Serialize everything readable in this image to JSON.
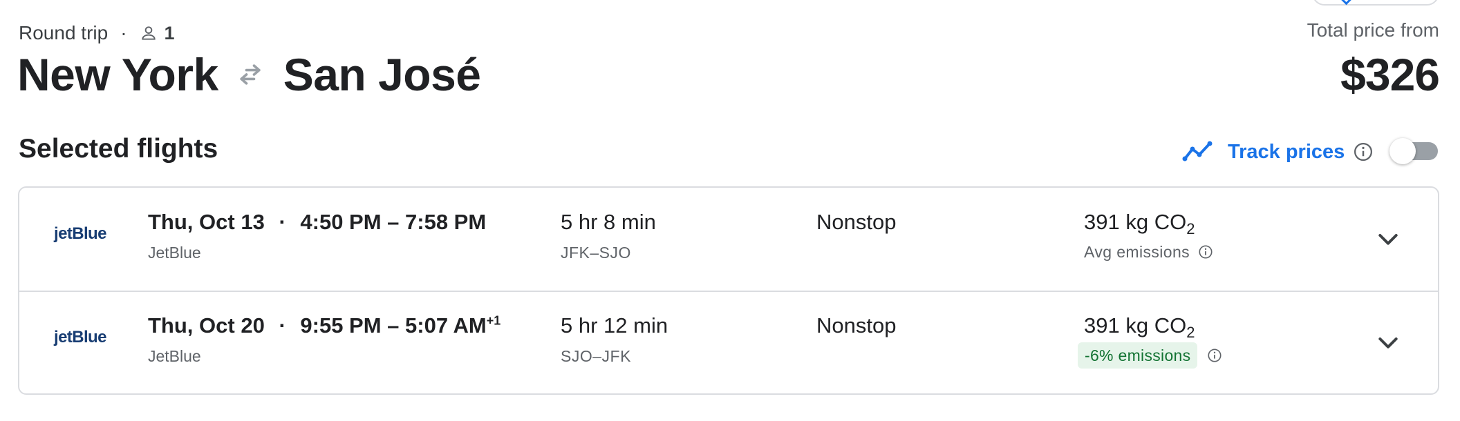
{
  "trip": {
    "type_label": "Round trip",
    "separator": "·",
    "passenger_count": "1",
    "icons": {
      "passenger": "person-icon"
    }
  },
  "route": {
    "origin": "New York",
    "destination": "San José",
    "icons": {
      "swap": "swap-arrows-icon"
    }
  },
  "price": {
    "label": "Total price from",
    "value": "$326"
  },
  "selected_flights": {
    "title": "Selected flights",
    "track_prices": {
      "label": "Track prices",
      "enabled": false,
      "icons": {
        "trend": "trend-line-icon",
        "info": "info-icon"
      }
    },
    "flights": [
      {
        "airline_logo": "jetBlue",
        "date": "Thu, Oct 13",
        "dot": "·",
        "times": "4:50 PM – 7:58 PM",
        "day_offset": "",
        "airline": "JetBlue",
        "duration": "5 hr 8 min",
        "airports": "JFK–SJO",
        "stops": "Nonstop",
        "emissions_value": "391 kg CO",
        "emissions_sub": "2",
        "emissions_note": "Avg emissions"
      },
      {
        "airline_logo": "jetBlue",
        "date": "Thu, Oct 20",
        "dot": "·",
        "times": "9:55 PM – 5:07 AM",
        "day_offset": "+1",
        "airline": "JetBlue",
        "duration": "5 hr 12 min",
        "airports": "SJO–JFK",
        "stops": "Nonstop",
        "emissions_value": "391 kg CO",
        "emissions_sub": "2",
        "emissions_note": "-6% emissions"
      }
    ]
  },
  "colors": {
    "accent": "#1a73e8",
    "logo": "#183d73",
    "positive_bg": "#e6f4ea",
    "positive_text": "#137333",
    "border": "#dadce0"
  }
}
